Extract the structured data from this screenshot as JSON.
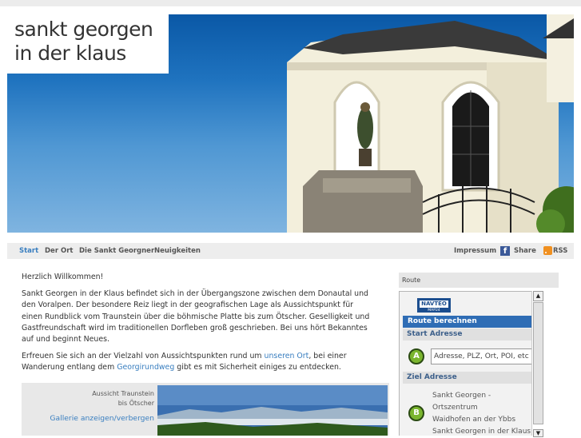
{
  "site": {
    "logo_line1": "sankt georgen",
    "logo_line2": "in der klaus"
  },
  "nav": {
    "items": [
      {
        "label": "Start",
        "active": true
      },
      {
        "label": "Der Ort"
      },
      {
        "label": "Die Sankt Georgner"
      },
      {
        "label": "Neuigkeiten"
      }
    ],
    "impressum": "Impressum",
    "share": "Share",
    "rss": "RSS"
  },
  "content": {
    "greeting": "Herzlich Willkommen!",
    "para1": "Sankt Georgen in der Klaus befindet sich in der Übergangszone zwischen dem Donautal und den Voralpen. Der besondere Reiz liegt in der geografischen Lage als Aussichtspunkt für einen Rundblick vom Traunstein über die böhmische Platte bis zum Ötscher. Geselligkeit und Gastfreundschaft wird im traditionellen Dorfleben groß geschrieben. Bei uns hört Bekanntes auf und beginnt Neues.",
    "para2_a": "Erfreuen Sie sich an der Vielzahl von Aussichtspunkten rund um ",
    "para2_link1": "unseren Ort",
    "para2_b": ", bei einer Wanderung entlang dem ",
    "para2_link2": "Georgirundweg",
    "para2_c": " gibt es mit Sicherheit einiges zu entdecken."
  },
  "gallery": {
    "caption_line1": "Aussicht Traunstein",
    "caption_line2": "bis Ötscher",
    "toggle": "Gallerie anzeigen/verbergen"
  },
  "route": {
    "heading": "Route",
    "logo_top": "NAVTEO",
    "logo_sub": "MAP24",
    "calc_label": "Route berechnen",
    "start_label": "Start Adresse",
    "start_marker": "A",
    "start_placeholder": "Adresse, PLZ, Ort, POI, etc.",
    "dest_label": "Ziel Adresse",
    "dest_marker": "B",
    "dest_lines": [
      "Sankt Georgen -",
      "Ortszentrum",
      "Waidhofen an der Ybbs",
      "Sankt Georgen in der Klaus"
    ]
  },
  "colors": {
    "accent": "#3a7fc0",
    "route_bar": "#2f6db5",
    "marker_green": "#7ab52e"
  },
  "icons": {
    "share": "facebook-icon",
    "rss": "rss-icon",
    "scroll_up": "arrow-up-icon",
    "scroll_down": "arrow-down-icon"
  }
}
